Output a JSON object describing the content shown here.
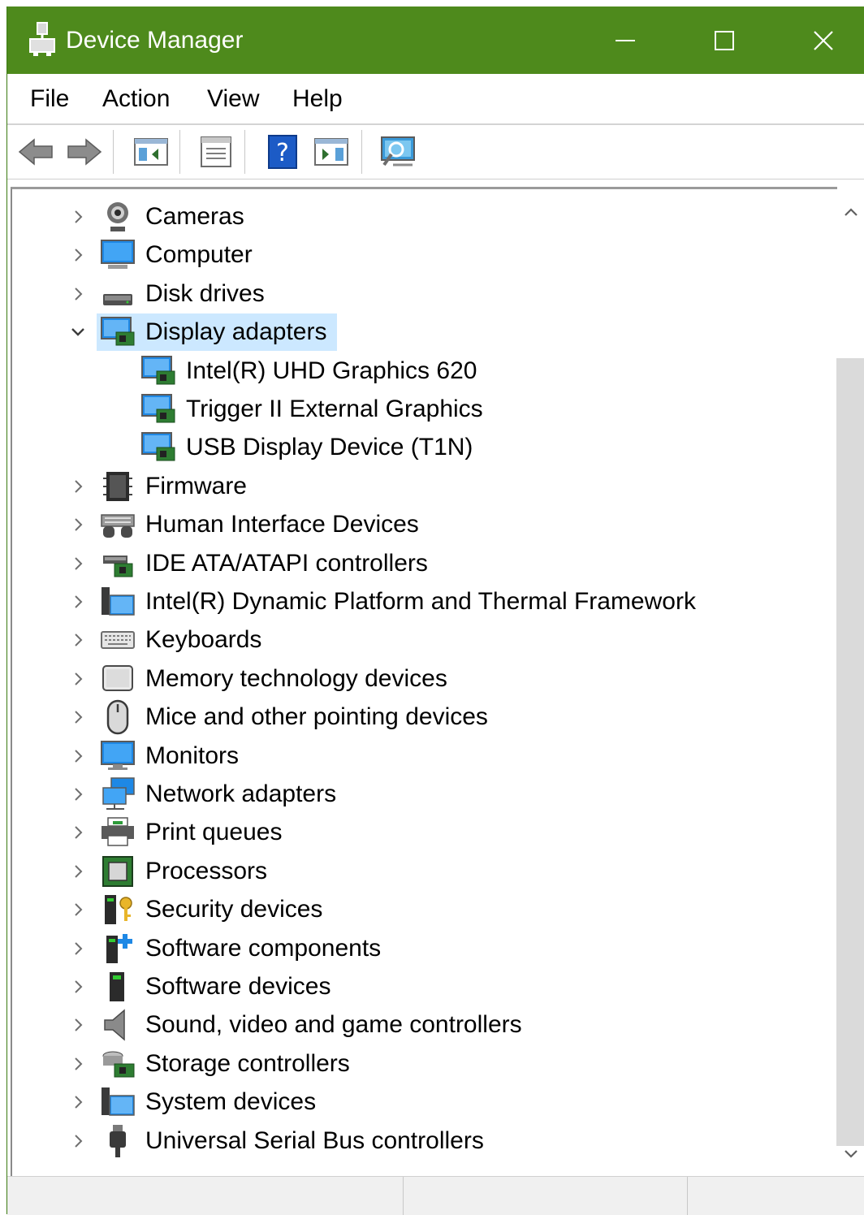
{
  "window": {
    "title": "Device Manager",
    "accent": "#4e8a1c",
    "selection_color": "#cce8ff"
  },
  "menubar": {
    "items": [
      "File",
      "Action",
      "View",
      "Help"
    ]
  },
  "toolbar": {
    "buttons": [
      {
        "icon": "back-arrow-icon"
      },
      {
        "icon": "forward-arrow-icon"
      },
      {
        "icon": "show-hide-console-tree-icon"
      },
      {
        "icon": "properties-icon"
      },
      {
        "icon": "help-icon"
      },
      {
        "icon": "action-pane-icon"
      },
      {
        "icon": "scan-hardware-changes-icon"
      }
    ]
  },
  "tree": {
    "items": [
      {
        "label": "Cameras",
        "icon": "camera-icon",
        "expanded": false
      },
      {
        "label": "Computer",
        "icon": "computer-icon",
        "expanded": false
      },
      {
        "label": "Disk drives",
        "icon": "disk-drive-icon",
        "expanded": false
      },
      {
        "label": "Display adapters",
        "icon": "display-adapter-icon",
        "expanded": true,
        "selected": true
      },
      {
        "label": "Intel(R) UHD Graphics 620",
        "icon": "display-adapter-icon",
        "child": true
      },
      {
        "label": "Trigger II External Graphics",
        "icon": "display-adapter-icon",
        "child": true
      },
      {
        "label": "USB Display Device (T1N)",
        "icon": "display-adapter-icon",
        "child": true
      },
      {
        "label": "Firmware",
        "icon": "firmware-icon",
        "expanded": false
      },
      {
        "label": "Human Interface Devices",
        "icon": "hid-icon",
        "expanded": false
      },
      {
        "label": "IDE ATA/ATAPI controllers",
        "icon": "ide-controller-icon",
        "expanded": false
      },
      {
        "label": "Intel(R) Dynamic Platform and Thermal Framework",
        "icon": "system-folder-icon",
        "expanded": false
      },
      {
        "label": "Keyboards",
        "icon": "keyboard-icon",
        "expanded": false
      },
      {
        "label": "Memory technology devices",
        "icon": "memory-device-icon",
        "expanded": false
      },
      {
        "label": "Mice and other pointing devices",
        "icon": "mouse-icon",
        "expanded": false
      },
      {
        "label": "Monitors",
        "icon": "monitor-icon",
        "expanded": false
      },
      {
        "label": "Network adapters",
        "icon": "network-adapter-icon",
        "expanded": false
      },
      {
        "label": "Print queues",
        "icon": "printer-icon",
        "expanded": false
      },
      {
        "label": "Processors",
        "icon": "processor-icon",
        "expanded": false
      },
      {
        "label": "Security devices",
        "icon": "security-key-icon",
        "expanded": false
      },
      {
        "label": "Software components",
        "icon": "software-component-icon",
        "expanded": false
      },
      {
        "label": "Software devices",
        "icon": "software-device-icon",
        "expanded": false
      },
      {
        "label": "Sound, video and game controllers",
        "icon": "speaker-icon",
        "expanded": false
      },
      {
        "label": "Storage controllers",
        "icon": "storage-controller-icon",
        "expanded": false
      },
      {
        "label": "System devices",
        "icon": "system-folder-icon",
        "expanded": false
      },
      {
        "label": "Universal Serial Bus controllers",
        "icon": "usb-plug-icon",
        "expanded": false
      }
    ]
  }
}
